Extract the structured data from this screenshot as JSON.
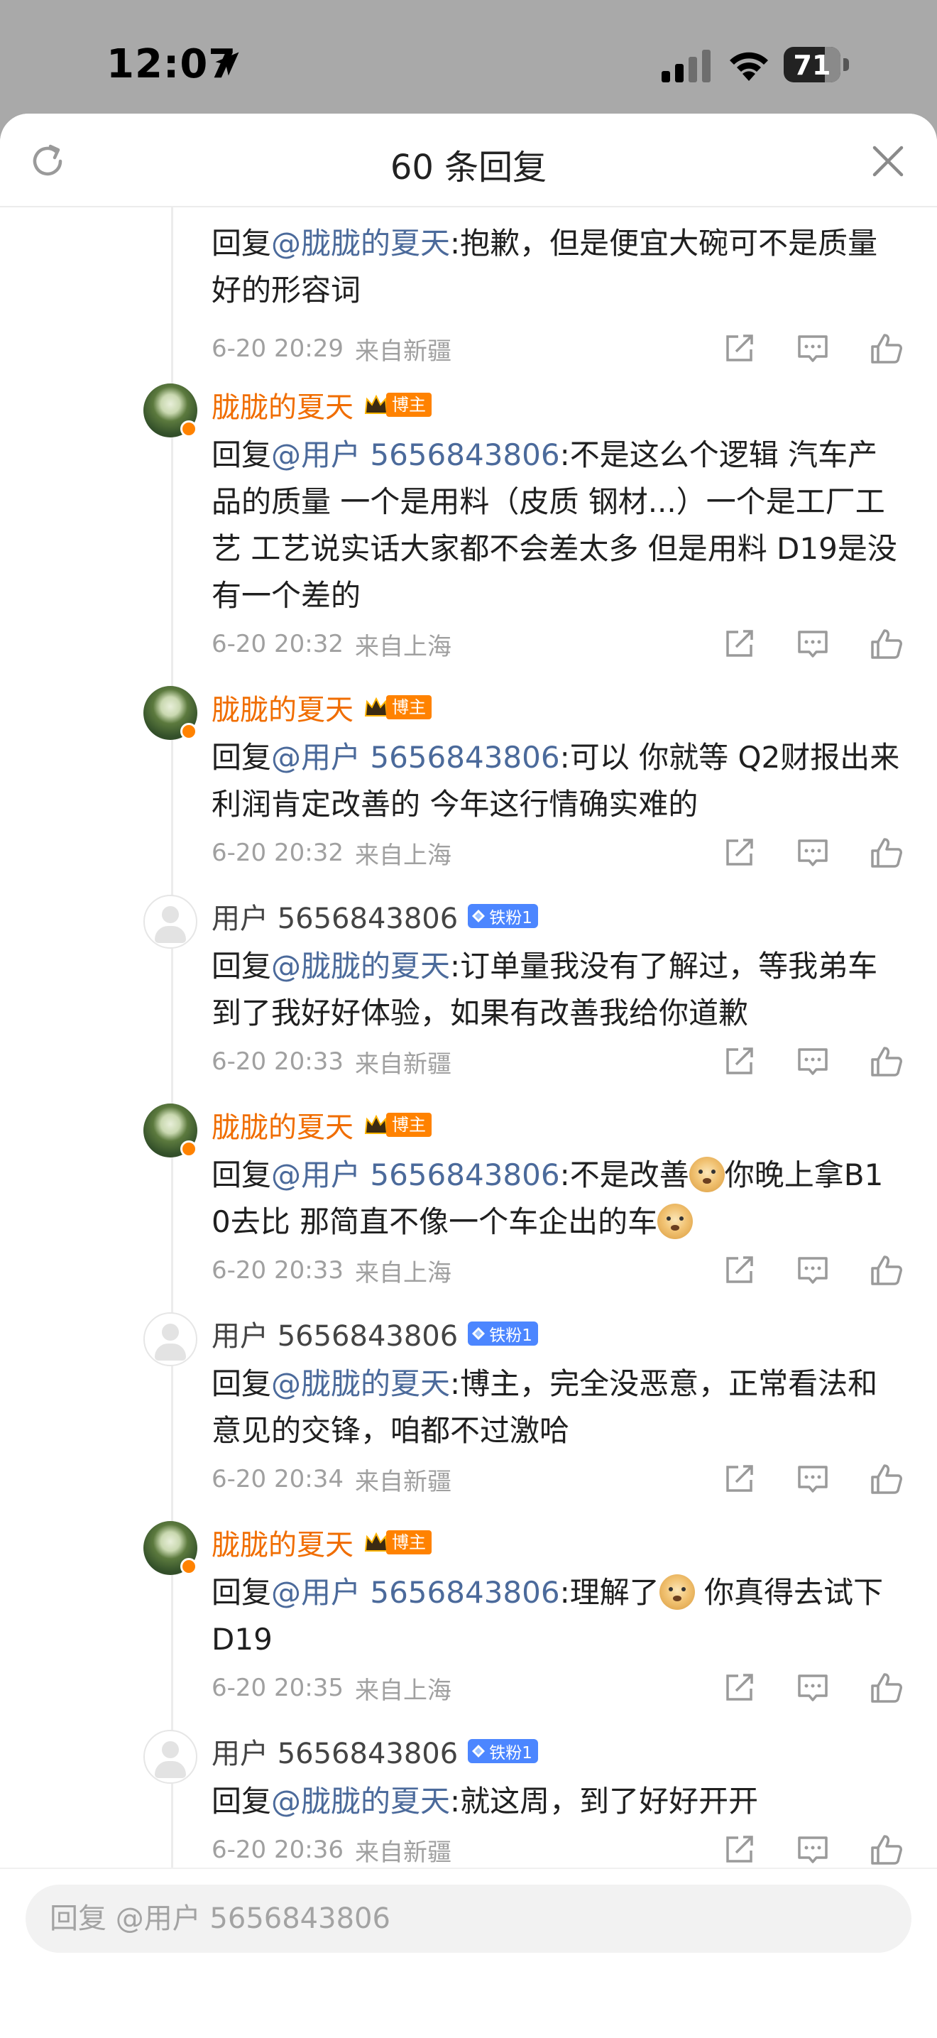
{
  "status": {
    "time": "12:07",
    "battery": "71"
  },
  "header": {
    "title": "60 条回复"
  },
  "icons": {
    "refresh": "refresh-icon",
    "close": "close-icon",
    "share": "share-icon",
    "comment": "comment-icon",
    "like": "like-icon",
    "location": "location-arrow-icon",
    "signal": "signal-icon",
    "wifi": "wifi-icon"
  },
  "colors": {
    "blogger_name": "#f06d00",
    "mention": "#4b6a9b",
    "badge_blogger": "#ff8200",
    "badge_fan": "#4c86ff"
  },
  "comments": [
    {
      "user": "",
      "reply_prefix": "回复",
      "mention": "@胧胧的夏天",
      "text": ":抱歉，但是便宜大碗可不是质量好的形容词",
      "time": "6-20 20:29",
      "location": "来自新疆"
    },
    {
      "user": "胧胧的夏天",
      "badge": "博主",
      "reply_prefix": "回复",
      "mention": "@用户 5656843806",
      "text": ":不是这么个逻辑 汽车产品的质量 一个是用料（皮质 钢材...）一个是工厂工艺 工艺说实话大家都不会差太多 但是用料 D19是没有一个差的",
      "time": "6-20 20:32",
      "location": "来自上海"
    },
    {
      "user": "胧胧的夏天",
      "badge": "博主",
      "reply_prefix": "回复",
      "mention": "@用户 5656843806",
      "text": ":可以 你就等 Q2财报出来 利润肯定改善的 今年这行情确实难的",
      "time": "6-20 20:32",
      "location": "来自上海"
    },
    {
      "user": "用户 5656843806",
      "badge": "铁粉1",
      "reply_prefix": "回复",
      "mention": "@胧胧的夏天",
      "text": ":订单量我没有了解过，等我弟车到了我好好体验，如果有改善我给你道歉",
      "time": "6-20 20:33",
      "location": "来自新疆"
    },
    {
      "user": "胧胧的夏天",
      "badge": "博主",
      "reply_prefix": "回复",
      "mention": "@用户 5656843806",
      "text_a": ":不是改善",
      "text_b": "你晚上拿B10去比 那简直不像一个车企出的车",
      "time": "6-20 20:33",
      "location": "来自上海"
    },
    {
      "user": "用户 5656843806",
      "badge": "铁粉1",
      "reply_prefix": "回复",
      "mention": "@胧胧的夏天",
      "text": ":博主，完全没恶意，正常看法和意见的交锋，咱都不过激哈",
      "time": "6-20 20:34",
      "location": "来自新疆"
    },
    {
      "user": "胧胧的夏天",
      "badge": "博主",
      "reply_prefix": "回复",
      "mention": "@用户 5656843806",
      "text_a": ":理解了",
      "text_b": " 你真得去试下D19",
      "time": "6-20 20:35",
      "location": "来自上海"
    },
    {
      "user": "用户 5656843806",
      "badge": "铁粉1",
      "reply_prefix": "回复",
      "mention": "@胧胧的夏天",
      "text": ":就这周，到了好好开开",
      "time": "6-20 20:36",
      "location": "来自新疆"
    }
  ],
  "input": {
    "placeholder": "回复 @用户 5656843806"
  }
}
